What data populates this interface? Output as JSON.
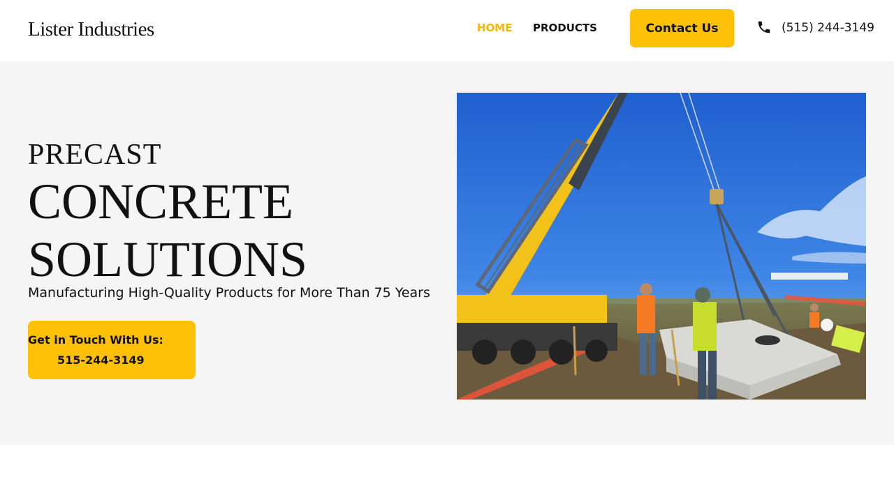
{
  "header": {
    "logo": "Lister Industries",
    "nav": [
      {
        "label": "HOME",
        "active": true
      },
      {
        "label": "PRODUCTS",
        "active": false
      }
    ],
    "contact_label": "Contact Us",
    "phone": "(515) 244-3149",
    "phone_icon": "phone-icon"
  },
  "hero": {
    "line1": "PRECAST",
    "line2": "CONCRETE",
    "line3": "SOLUTIONS",
    "subtitle": "Manufacturing High-Quality Products for More Than 75 Years",
    "cta_line1": "Get in Touch With Us:",
    "cta_line2": "515-244-3149"
  },
  "colors": {
    "accent": "#ffc107",
    "active_nav": "#f5b800",
    "hero_bg": "#f5f5f5",
    "text": "#111111"
  }
}
